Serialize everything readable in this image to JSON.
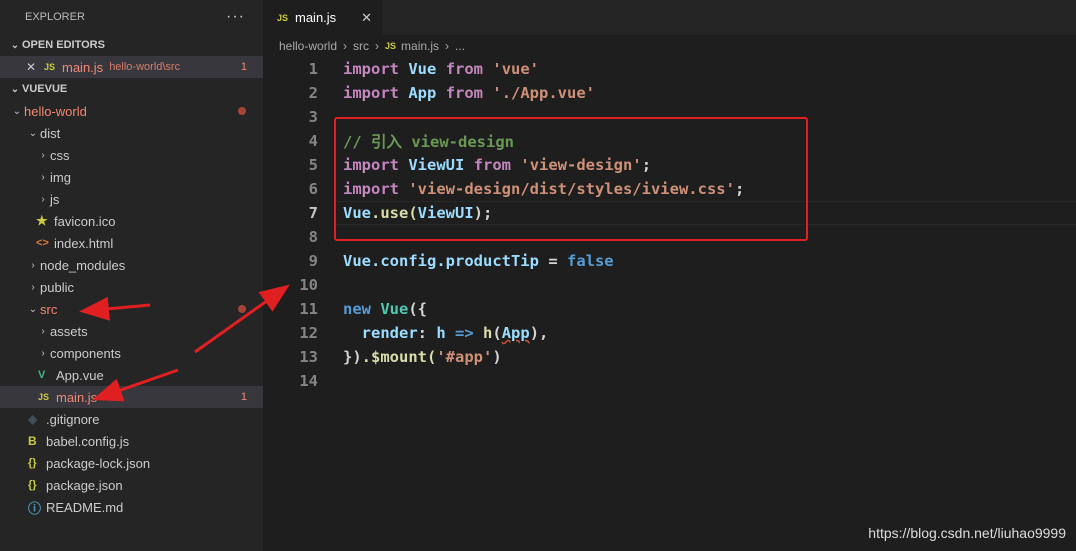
{
  "explorer": {
    "title": "EXPLORER",
    "more": "···",
    "open_editors_label": "OPEN EDITORS",
    "open_editors": [
      {
        "icon": "JS",
        "name": "main.js",
        "path": "hello-world\\src",
        "badge": "1"
      }
    ],
    "workspace_label": "VUEVUE",
    "tree": [
      {
        "chev": "⌄",
        "name": "hello-world",
        "status": "dot"
      },
      {
        "chev": "⌄",
        "name": "dist"
      },
      {
        "chev": "›",
        "name": "css"
      },
      {
        "chev": "›",
        "name": "img"
      },
      {
        "chev": "›",
        "name": "js"
      },
      {
        "icon": "★",
        "name": "favicon.ico"
      },
      {
        "icon": "<>",
        "name": "index.html"
      },
      {
        "chev": "›",
        "name": "node_modules"
      },
      {
        "chev": "›",
        "name": "public"
      },
      {
        "chev": "⌄",
        "name": "src",
        "status": "dot"
      },
      {
        "chev": "›",
        "name": "assets"
      },
      {
        "chev": "›",
        "name": "components"
      },
      {
        "icon": "V",
        "name": "App.vue"
      },
      {
        "icon": "JS",
        "name": "main.js",
        "badge": "1"
      },
      {
        "icon": "◈",
        "name": ".gitignore"
      },
      {
        "icon": "B",
        "name": "babel.config.js"
      },
      {
        "icon": "{}",
        "name": "package-lock.json"
      },
      {
        "icon": "{}",
        "name": "package.json"
      },
      {
        "icon": "ⓘ",
        "name": "README.md"
      }
    ]
  },
  "tab": {
    "icon": "JS",
    "name": "main.js",
    "close": "✕"
  },
  "breadcrumb": {
    "a": "hello-world",
    "b": "src",
    "icon": "JS",
    "c": "main.js",
    "d": "..."
  },
  "code": {
    "line_numbers": [
      "1",
      "2",
      "3",
      "4",
      "5",
      "6",
      "7",
      "8",
      "9",
      "10",
      "11",
      "12",
      "13",
      "14"
    ],
    "l1": {
      "k": "import",
      "a": "Vue",
      "f": "from",
      "s": "'vue'"
    },
    "l2": {
      "k": "import",
      "a": "App",
      "f": "from",
      "s": "'./App.vue'"
    },
    "l4": "// 引入 view-design",
    "l5": {
      "k": "import",
      "a": "ViewUI",
      "f": "from",
      "s": "'view-design'",
      "e": ";"
    },
    "l6": {
      "k": "import",
      "s": "'view-design/dist/styles/iview.css'",
      "e": ";"
    },
    "l7": {
      "a": "Vue",
      "b": ".use(",
      "c": "ViewUI",
      "d": ");"
    },
    "l9": {
      "a": "Vue",
      "b": ".config.productTip",
      "c": " = ",
      "d": "false"
    },
    "l11": {
      "k": "new",
      "a": "Vue",
      "b": "({"
    },
    "l12": {
      "a": "  render",
      "b": ": ",
      "c": "h",
      "d": " => ",
      "e": "h",
      "f": "(",
      "g": "App",
      "h": "),"
    },
    "l13": {
      "a": "})",
      "b": ".$mount(",
      "c": "'#app'",
      "d": ")"
    }
  },
  "watermark": "https://blog.csdn.net/liuhao9999"
}
